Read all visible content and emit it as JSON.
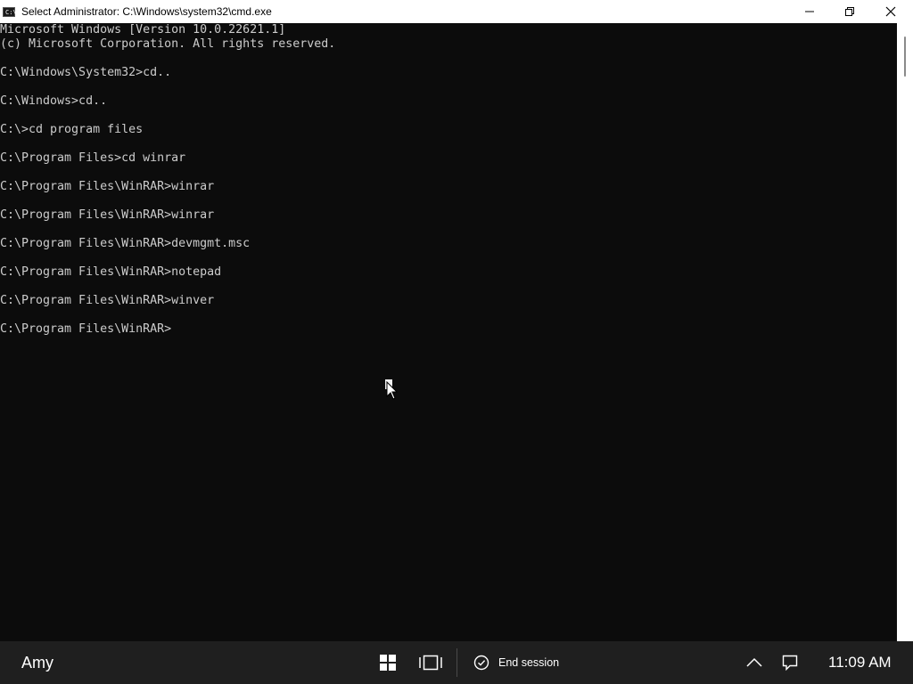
{
  "window": {
    "title": "Select Administrator: C:\\Windows\\system32\\cmd.exe",
    "icon": "cmd-icon",
    "icon_text": "C:\\"
  },
  "terminal": {
    "lines": [
      "Microsoft Windows [Version 10.0.22621.1]",
      "(c) Microsoft Corporation. All rights reserved.",
      "",
      "C:\\Windows\\System32>cd..",
      "",
      "C:\\Windows>cd..",
      "",
      "C:\\>cd program files",
      "",
      "C:\\Program Files>cd winrar",
      "",
      "C:\\Program Files\\WinRAR>winrar",
      "",
      "C:\\Program Files\\WinRAR>winrar",
      "",
      "C:\\Program Files\\WinRAR>devmgmt.msc",
      "",
      "C:\\Program Files\\WinRAR>notepad",
      "",
      "C:\\Program Files\\WinRAR>winver",
      "",
      "C:\\Program Files\\WinRAR>"
    ]
  },
  "taskbar": {
    "user_name": "Amy",
    "end_session_label": "End session",
    "clock": "11:09 AM"
  },
  "colors": {
    "terminal_bg": "#0c0c0c",
    "terminal_fg": "#cccccc",
    "taskbar_bg": "#1f1f1f",
    "titlebar_bg": "#ffffff"
  }
}
